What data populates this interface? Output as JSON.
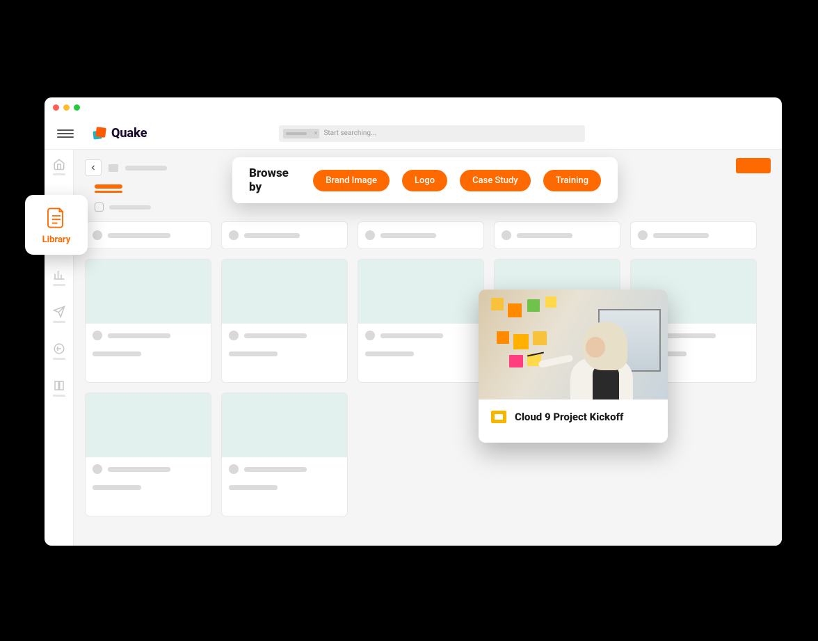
{
  "app": {
    "name": "Quake"
  },
  "search": {
    "placeholder": "Start searching..."
  },
  "library_badge": {
    "label": "Library"
  },
  "browse": {
    "title": "Browse by",
    "chips": [
      "Brand Image",
      "Logo",
      "Case Study",
      "Training"
    ]
  },
  "preview": {
    "title": "Cloud 9 Project Kickoff",
    "icon": "google-slides-icon"
  },
  "colors": {
    "accent": "#ff6a00",
    "thumb": "#e2f0ee"
  }
}
